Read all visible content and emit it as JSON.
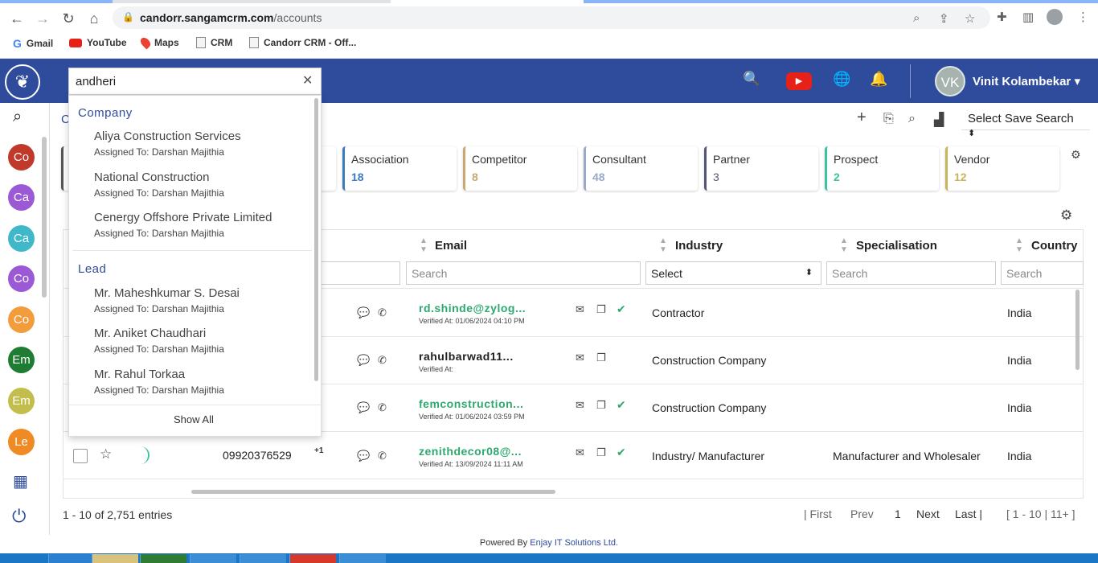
{
  "browser": {
    "url_domain": "candorr.sangamcrm.com",
    "url_path": "/accounts",
    "bookmarks": [
      {
        "label": "Gmail",
        "icon": "google-icon"
      },
      {
        "label": "YouTube",
        "icon": "youtube-icon"
      },
      {
        "label": "Maps",
        "icon": "maps-icon"
      },
      {
        "label": "CRM",
        "icon": "doc-icon"
      },
      {
        "label": "Candorr CRM - Off...",
        "icon": "doc-icon"
      }
    ]
  },
  "header": {
    "user_initials": "VK",
    "user_name": "Vinit Kolambekar",
    "brand_color": "#2f4b9b"
  },
  "rail": {
    "items": [
      {
        "label": "Co",
        "color": "#c0392b"
      },
      {
        "label": "Ca",
        "color": "#9b59d6"
      },
      {
        "label": "Ca",
        "color": "#3fb8c9"
      },
      {
        "label": "Co",
        "color": "#9b59d6"
      },
      {
        "label": "Co",
        "color": "#f39c3c"
      },
      {
        "label": "Em",
        "color": "#1e7d32"
      },
      {
        "label": "Em",
        "color": "#c3bd4b"
      },
      {
        "label": "Le",
        "color": "#f08a24"
      }
    ]
  },
  "search": {
    "query": "andheri",
    "groups": [
      {
        "title": "Company",
        "items": [
          {
            "name": "Aliya Construction Services",
            "assigned": "Assigned To: Darshan Majithia"
          },
          {
            "name": "National Construction",
            "assigned": "Assigned To: Darshan Majithia"
          },
          {
            "name": "Cenergy Offshore Private Limited",
            "assigned": "Assigned To: Darshan Majithia"
          }
        ]
      },
      {
        "title": "Lead",
        "items": [
          {
            "name": "Mr. Maheshkumar S. Desai",
            "assigned": "Assigned To: Darshan Majithia"
          },
          {
            "name": "Mr. Aniket Chaudhari",
            "assigned": "Assigned To: Darshan Majithia"
          },
          {
            "name": "Mr. Rahul Torkaa",
            "assigned": "Assigned To: Darshan Majithia"
          }
        ]
      }
    ],
    "show_all": "Show All"
  },
  "toolbar": {
    "title_fragment": "C",
    "save_search": "Select Save Search"
  },
  "cards": [
    {
      "label": "Association",
      "value": "18",
      "color": "#3a7abf"
    },
    {
      "label": "Competitor",
      "value": "8",
      "color": "#c9a872"
    },
    {
      "label": "Consultant",
      "value": "48",
      "color": "#9aa9c9"
    },
    {
      "label": "Partner",
      "value": "3",
      "color": "#555577"
    },
    {
      "label": "Prospect",
      "value": "2",
      "color": "#3cc2a0"
    },
    {
      "label": "Vendor",
      "value": "12",
      "color": "#c9b45a"
    }
  ],
  "table": {
    "columns": [
      "Email",
      "Industry",
      "Specialisation",
      "Country"
    ],
    "filters": {
      "first": "",
      "email": "Search",
      "industry": "Select",
      "specialisation": "Search",
      "country": "Search"
    },
    "rows": [
      {
        "phone": "",
        "extra": "",
        "email": "rd.shinde@zylog...",
        "email_color": "#2ea86f",
        "verified": "Verified At: 01/06/2024 04:10 PM",
        "checked": true,
        "industry": "Contractor",
        "specialisation": "",
        "country": "India"
      },
      {
        "phone": "",
        "extra": "",
        "email": "rahulbarwad11...",
        "email_color": "#222222",
        "verified": "Verified At:",
        "checked": false,
        "industry": "Construction Company",
        "specialisation": "",
        "country": "India"
      },
      {
        "phone": "",
        "extra": "",
        "email": "femconstruction...",
        "email_color": "#2ea86f",
        "verified": "Verified At: 01/06/2024 03:59 PM",
        "checked": true,
        "industry": "Construction Company",
        "specialisation": "",
        "country": "India"
      },
      {
        "phone": "09920376529",
        "extra": "+1",
        "email": "zenithdecor08@...",
        "email_color": "#2ea86f",
        "verified": "Verified At: 13/09/2024 11:11 AM",
        "checked": true,
        "industry": "Industry/ Manufacturer",
        "specialisation": "Manufacturer and Wholesaler",
        "country": "India"
      }
    ]
  },
  "pagination": {
    "entries": "1 - 10 of 2,751 entries",
    "first": "| First",
    "prev": "Prev",
    "page": "1",
    "next": "Next",
    "last": "Last |",
    "range": "[ 1 - 10 | 11+ ]"
  },
  "footer": {
    "powered_prefix": "Powered By ",
    "powered_company": "Enjay IT Solutions Ltd."
  }
}
